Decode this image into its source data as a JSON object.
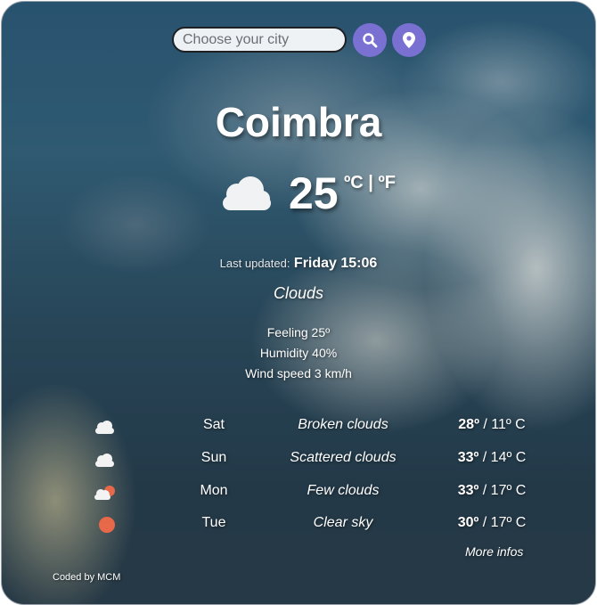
{
  "search": {
    "placeholder": "Choose your city"
  },
  "icons": {
    "search_button": "search-icon",
    "location_button": "location-pin-icon",
    "accent": "#8474e0"
  },
  "current": {
    "city": "Coimbra",
    "icon": "clouds-icon",
    "temperature": "25",
    "unit_c": "ºC",
    "unit_sep": " | ",
    "unit_f": "ºF",
    "updated_label": "Last updated:",
    "updated_value": "Friday 15:06",
    "description": "Clouds",
    "feeling": "Feeling 25º",
    "humidity": "Humidity 40%",
    "wind": "Wind speed 3 km/h"
  },
  "forecast": [
    {
      "icon": "broken-clouds-icon",
      "day": "Sat",
      "description": "Broken clouds",
      "max": "28º",
      "min": "11º C"
    },
    {
      "icon": "scattered-clouds-icon",
      "day": "Sun",
      "description": "Scattered clouds",
      "max": "33º",
      "min": "14º C"
    },
    {
      "icon": "few-clouds-icon",
      "day": "Mon",
      "description": "Few clouds",
      "max": "33º",
      "min": "17º C"
    },
    {
      "icon": "clear-sky-icon",
      "day": "Tue",
      "description": "Clear sky",
      "max": "30º",
      "min": "17º C"
    }
  ],
  "footer": {
    "more_link": "More infos",
    "credit": "Coded by MCM"
  }
}
